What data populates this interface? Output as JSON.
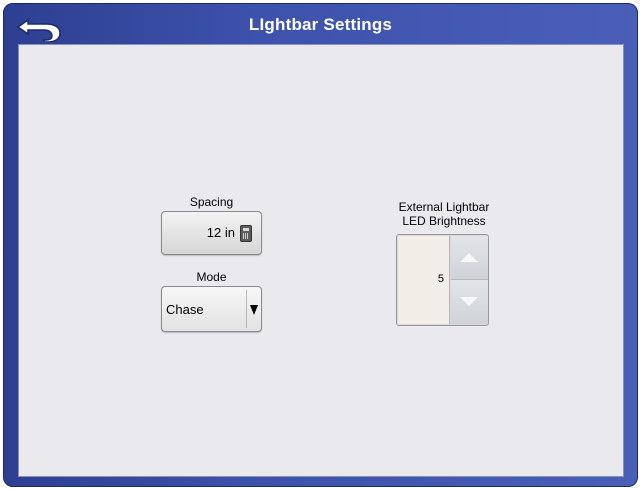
{
  "header": {
    "title": "LIghtbar Settings",
    "back_icon": "back-arrow-icon"
  },
  "spacing": {
    "label": "Spacing",
    "value": "12 in",
    "icon": "calculator-icon"
  },
  "mode": {
    "label": "Mode",
    "selected": "Chase"
  },
  "led_brightness": {
    "label_line1": "External Lightbar",
    "label_line2": "LED Brightness",
    "value": "5"
  },
  "colors": {
    "titlebar_blue": "#3d52ab",
    "panel_background": "#e9e9ee"
  }
}
